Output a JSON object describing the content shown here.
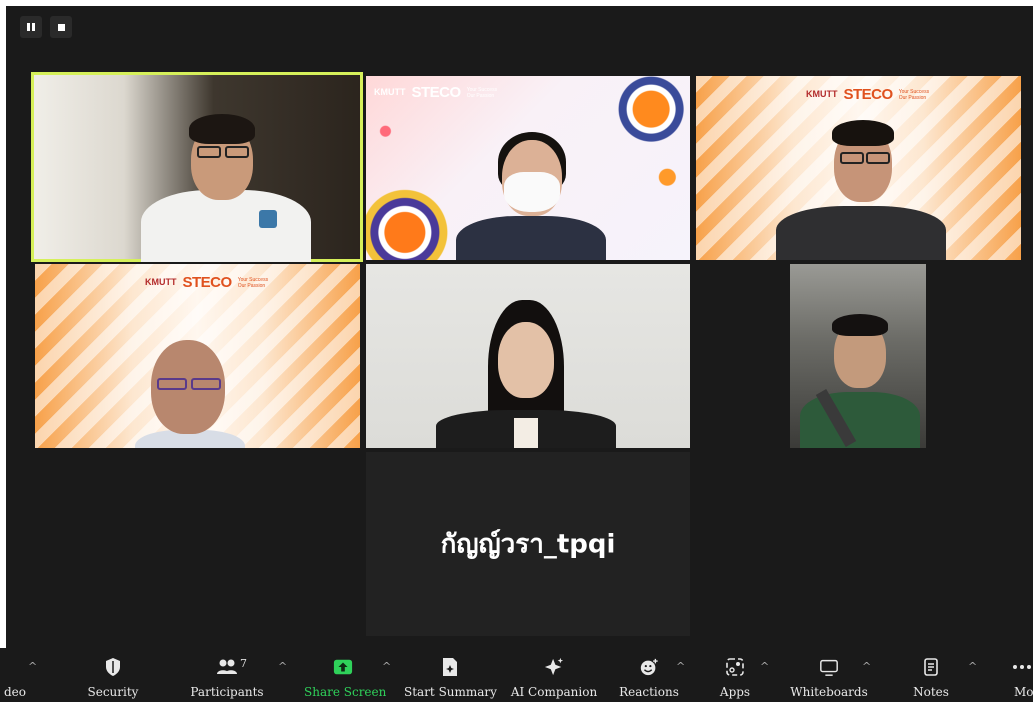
{
  "top_controls": {
    "pause": "pause-icon",
    "stop": "stop-icon"
  },
  "participants_name_tile": "กัญญ์วรา_tpqi",
  "logos": {
    "kmutt": "KMUTT",
    "steco": "STECO",
    "tagline": "Your Success Our Passion"
  },
  "toolbar": {
    "video_label": "deo",
    "security_label": "Security",
    "participants_label": "Participants",
    "participants_count": "7",
    "share_label": "Share Screen",
    "summary_label": "Start Summary",
    "ai_label": "AI Companion",
    "reactions_label": "Reactions",
    "apps_label": "Apps",
    "whiteboards_label": "Whiteboards",
    "notes_label": "Notes",
    "more_label": "Mo",
    "caret": "^"
  },
  "colors": {
    "active_speaker": "#d6f05a",
    "share_green": "#2fd15a",
    "toolbar_bg": "#1a1a1a"
  }
}
